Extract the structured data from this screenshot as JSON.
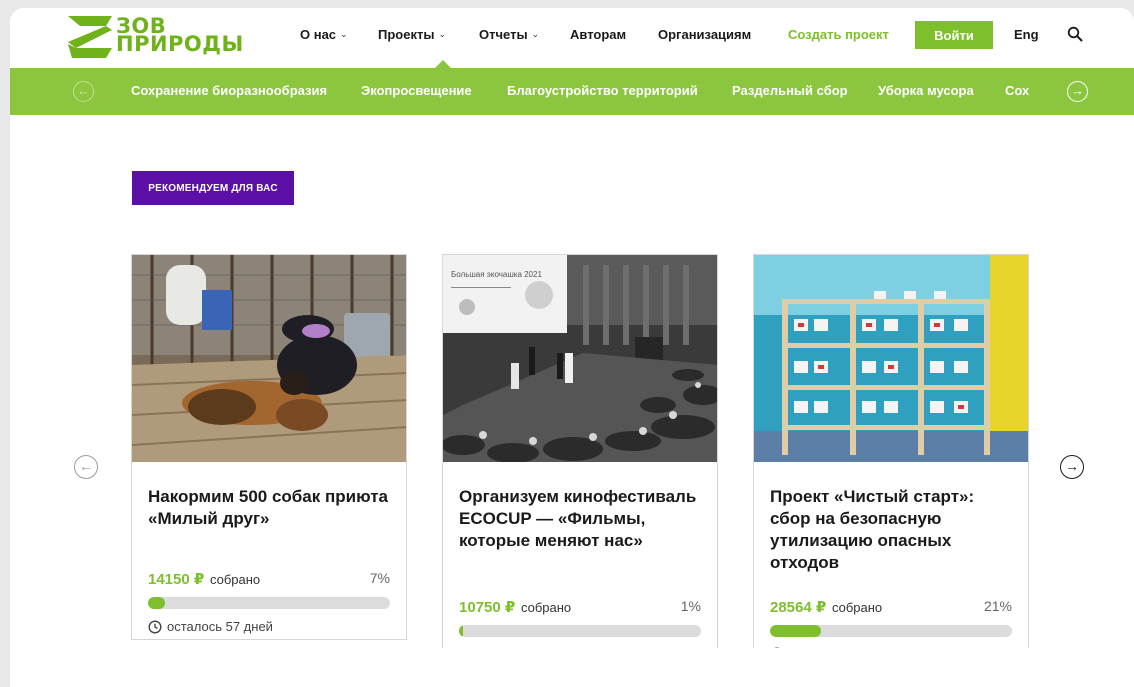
{
  "brand": {
    "line1": "ЗОВ",
    "line2": "ПРИРОДЫ",
    "color": "#6fb21b"
  },
  "nav": {
    "about": "О нас",
    "projects": "Проекты",
    "reports": "Отчеты",
    "authors": "Авторам",
    "organizations": "Организациям",
    "create_project": "Создать проект",
    "login": "Войти",
    "language": "Eng"
  },
  "categories": [
    "Сохранение биоразнообразия",
    "Экопросвещение",
    "Благоустройство территорий",
    "Раздельный сбор",
    "Уборка мусора",
    "Сох"
  ],
  "badge": "РЕКОМЕНДУЕМ ДЛЯ ВАС",
  "cards": [
    {
      "title": "Накормим 500 собак приюта «Милый друг»",
      "amount": "14150 ₽",
      "raised_label": "собрано",
      "percent_label": "7%",
      "progress": 0.07,
      "days_left": "осталось 57 дней"
    },
    {
      "title": "Организуем кинофестиваль ECOCUP — «Фильмы, которые меняют нас»",
      "amount": "10750 ₽",
      "raised_label": "собрано",
      "percent_label": "1%",
      "progress": 0.01,
      "photo_caption": "Большая экочашка 2021"
    },
    {
      "title": "Проект «Чистый старт»: сбор на безопасную утилизацию опасных отходов",
      "amount": "28564 ₽",
      "raised_label": "собрано",
      "percent_label": "21%",
      "progress": 0.21
    }
  ],
  "colors": {
    "accent": "#8cc63f",
    "accent_dark": "#7dbf2c",
    "badge": "#5c0fa7"
  }
}
